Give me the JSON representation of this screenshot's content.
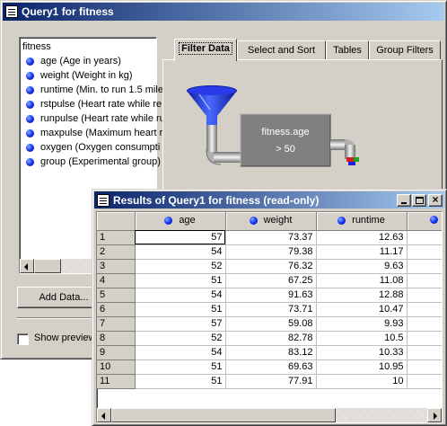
{
  "query_window": {
    "title": "Query1 for fitness",
    "library": "fitness",
    "variables": [
      {
        "label": "age (Age in years)"
      },
      {
        "label": "weight (Weight in kg)"
      },
      {
        "label": "runtime (Min. to run 1.5 mile"
      },
      {
        "label": "rstpulse (Heart rate while re"
      },
      {
        "label": "runpulse (Heart rate while ru"
      },
      {
        "label": "maxpulse (Maximum heart r"
      },
      {
        "label": "oxygen (Oxygen consumpti"
      },
      {
        "label": "group (Experimental group)"
      }
    ],
    "add_data_label": "Add Data...",
    "show_preview_label": "Show preview",
    "tabs": [
      "Filter Data",
      "Select and Sort",
      "Tables",
      "Group Filters"
    ],
    "active_tab": "Filter Data",
    "filter": {
      "variable": "fitness.age",
      "condition": "> 50"
    }
  },
  "results_window": {
    "title": "Results of Query1 for fitness (read-only)",
    "columns": [
      "age",
      "weight",
      "runtime"
    ],
    "rows": [
      {
        "n": "1",
        "age": "57",
        "weight": "73.37",
        "runtime": "12.63"
      },
      {
        "n": "2",
        "age": "54",
        "weight": "79.38",
        "runtime": "11.17"
      },
      {
        "n": "3",
        "age": "52",
        "weight": "76.32",
        "runtime": "9.63"
      },
      {
        "n": "4",
        "age": "51",
        "weight": "67.25",
        "runtime": "11.08"
      },
      {
        "n": "5",
        "age": "54",
        "weight": "91.63",
        "runtime": "12.88"
      },
      {
        "n": "6",
        "age": "51",
        "weight": "73.71",
        "runtime": "10.47"
      },
      {
        "n": "7",
        "age": "57",
        "weight": "59.08",
        "runtime": "9.93"
      },
      {
        "n": "8",
        "age": "52",
        "weight": "82.78",
        "runtime": "10.5"
      },
      {
        "n": "9",
        "age": "54",
        "weight": "83.12",
        "runtime": "10.33"
      },
      {
        "n": "10",
        "age": "51",
        "weight": "69.63",
        "runtime": "10.95"
      },
      {
        "n": "11",
        "age": "51",
        "weight": "77.91",
        "runtime": "10"
      }
    ]
  },
  "colors": {
    "titlebar_start": "#0a246a",
    "titlebar_end": "#a6caf0",
    "funnel": "#1e2dd8",
    "filter_box": "#808080"
  }
}
